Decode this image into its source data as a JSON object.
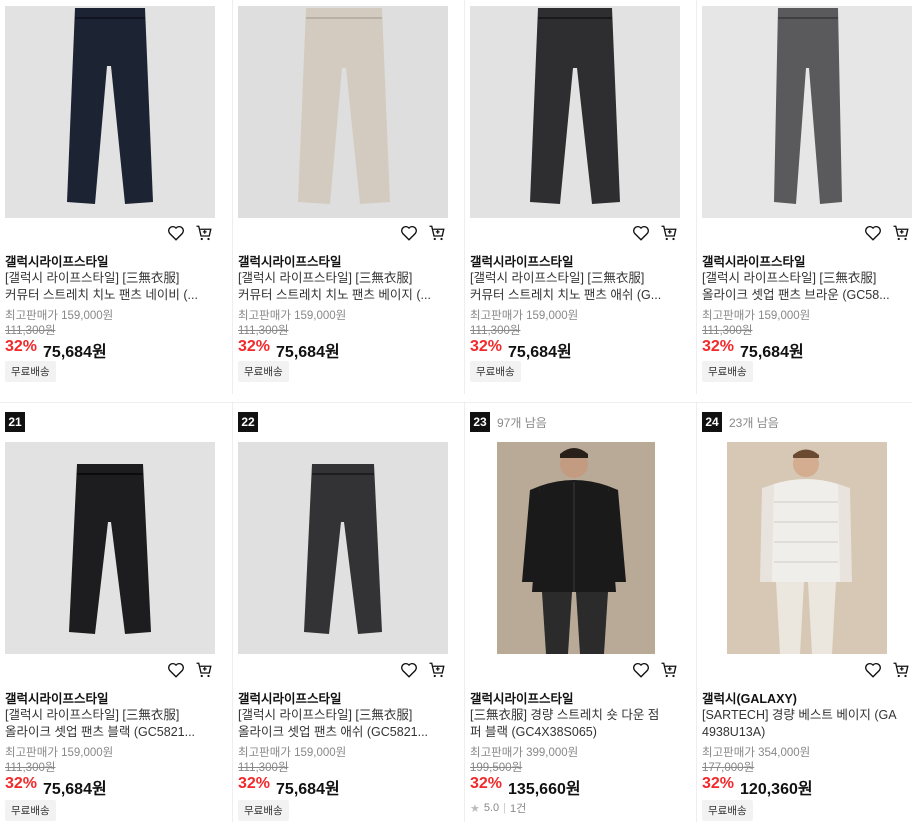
{
  "products": [
    {
      "brand": "갤럭시라이프스타일",
      "name1": "[갤럭시 라이프스타일] [三無衣服]",
      "name2": "커뮤터 스트레치 치노 팬츠 네이비 (...",
      "max_price": "최고판매가 159,000원",
      "original_price": "111,300원",
      "discount": "32%",
      "price": "75,684원",
      "badge": "무료배송",
      "image": "pants-navy",
      "color": "#1c2333"
    },
    {
      "brand": "갤럭시라이프스타일",
      "name1": "[갤럭시 라이프스타일] [三無衣服]",
      "name2": "커뮤터 스트레치 치노 팬츠 베이지 (...",
      "max_price": "최고판매가 159,000원",
      "original_price": "111,300원",
      "discount": "32%",
      "price": "75,684원",
      "badge": "무료배송",
      "image": "pants-beige",
      "color": "#d3cbbf"
    },
    {
      "brand": "갤럭시라이프스타일",
      "name1": "[갤럭시 라이프스타일] [三無衣服]",
      "name2": "커뮤터 스트레치 치노 팬츠 애쉬 (G...",
      "max_price": "최고판매가 159,000원",
      "original_price": "111,300원",
      "discount": "32%",
      "price": "75,684원",
      "badge": "무료배송",
      "image": "pants-ash",
      "color": "#2e2e30"
    },
    {
      "brand": "갤럭시라이프스타일",
      "name1": "[갤럭시 라이프스타일] [三無衣服]",
      "name2": "올라이크 셋업 팬츠 브라운 (GC58...",
      "max_price": "최고판매가 159,000원",
      "original_price": "111,300원",
      "discount": "32%",
      "price": "75,684원",
      "badge": "무료배송",
      "image": "pants-brown",
      "color": "#5a5a5c"
    },
    {
      "rank": "21",
      "brand": "갤럭시라이프스타일",
      "name1": "[갤럭시 라이프스타일] [三無衣服]",
      "name2": "올라이크 셋업 팬츠 블랙 (GC5821...",
      "max_price": "최고판매가 159,000원",
      "original_price": "111,300원",
      "discount": "32%",
      "price": "75,684원",
      "badge": "무료배송",
      "image": "pants-black",
      "color": "#1d1d1f"
    },
    {
      "rank": "22",
      "brand": "갤럭시라이프스타일",
      "name1": "[갤럭시 라이프스타일] [三無衣服]",
      "name2": "올라이크 셋업 팬츠 애쉬 (GC5821...",
      "max_price": "최고판매가 159,000원",
      "original_price": "111,300원",
      "discount": "32%",
      "price": "75,684원",
      "badge": "무료배송",
      "image": "pants-ash",
      "color": "#333336"
    },
    {
      "rank": "23",
      "stock": "97개 남음",
      "brand": "갤럭시라이프스타일",
      "name1": "[三無衣服] 경량 스트레치 숏 다운 점",
      "name2": "퍼 블랙 (GC4X38S065)",
      "max_price": "최고판매가 399,000원",
      "original_price": "199,500원",
      "discount": "32%",
      "price": "135,660원",
      "rating": "5.0",
      "reviews": "1건",
      "image": "model-black-down-jumper",
      "color": "#1a1a1a"
    },
    {
      "rank": "24",
      "stock": "23개 남음",
      "brand": "갤럭시(GALAXY)",
      "name1": "[SARTECH] 경량 베스트 베이지 (GA",
      "name2": "4938U13A)",
      "max_price": "최고판매가 354,000원",
      "original_price": "177,000원",
      "discount": "32%",
      "price": "120,360원",
      "badge": "무료배송",
      "image": "model-beige-vest",
      "color": "#e6e2dc"
    }
  ],
  "icons": {
    "wishlist": "heart-icon",
    "cart": "cart-icon",
    "rating": "star-icon"
  }
}
